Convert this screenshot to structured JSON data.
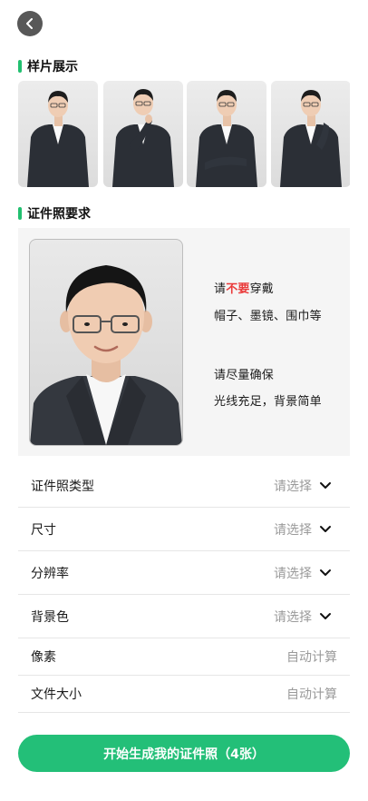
{
  "header": {
    "back_icon": "chevron-left-icon"
  },
  "samples_section": {
    "title": "样片展示"
  },
  "requirements_section": {
    "title": "证件照要求",
    "tip1_prefix": "请",
    "tip1_highlight": "不要",
    "tip1_suffix": "穿戴",
    "tip1_detail": "帽子、墨镜、围巾等",
    "tip2_title": "请尽量确保",
    "tip2_detail": "光线充足，背景简单"
  },
  "form": {
    "rows": [
      {
        "label": "证件照类型",
        "value": "请选择",
        "has_dropdown": true
      },
      {
        "label": "尺寸",
        "value": "请选择",
        "has_dropdown": true
      },
      {
        "label": "分辨率",
        "value": "请选择",
        "has_dropdown": true
      },
      {
        "label": "背景色",
        "value": "请选择",
        "has_dropdown": true
      },
      {
        "label": "像素",
        "value": "自动计算",
        "has_dropdown": false
      },
      {
        "label": "文件大小",
        "value": "自动计算",
        "has_dropdown": false
      }
    ]
  },
  "cta": {
    "label": "开始生成我的证件照（4张）"
  },
  "colors": {
    "accent": "#22c070",
    "highlight_red": "#ea3a3a",
    "cta_bg": "#23bf78"
  }
}
